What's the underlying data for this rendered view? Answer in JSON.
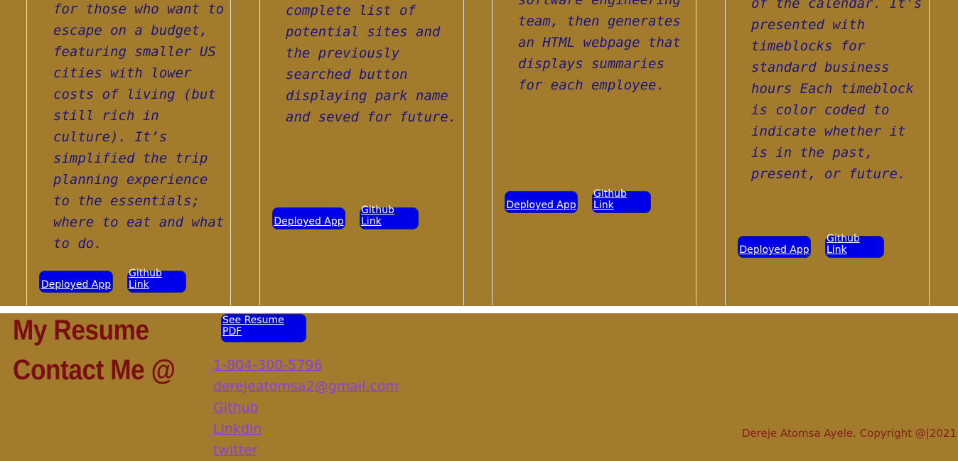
{
  "projects": [
    {
      "description": "for those who want to\nescape on a budget,\nfeaturing smaller US\ncities with lower\ncosts of living (but\nstill rich in\nculture). It’s\nsimplified the trip\nplanning experience\nto the essentials;\nwhere to eat and what\nto do.",
      "deployed_label": "Deployed App",
      "github_label": "Github Link"
    },
    {
      "description": "complete list of\npotential sites and\nthe previously\nsearched button\ndisplaying park name\nand seved for future.",
      "deployed_label": "Deployed App",
      "github_label": "Github Link"
    },
    {
      "description": "software engineering\nteam, then generates\nan HTML webpage that\ndisplays summaries\nfor each employee.",
      "deployed_label": "Deployed App",
      "github_label": "Github Link"
    },
    {
      "description": "of the calendar. It's\npresented with\ntimeblocks for\nstandard business\nhours Each timeblock\nis color coded to\nindicate whether it\nis in the past,\npresent, or future.",
      "deployed_label": "Deployed App",
      "github_label": "Github Link"
    }
  ],
  "footer": {
    "resume_heading": "My Resume",
    "resume_button": "See Resume PDF",
    "contact_heading": "Contact Me @",
    "contact_links": [
      "1-804-300-5796",
      "derejeatomsa2@gmail.com",
      "Github",
      "Linkdin",
      "twitter"
    ],
    "copyright": "Dereje Atomsa Ayele. Copyright @|2021"
  },
  "colors": {
    "background": "#a37b2d",
    "button": "#0000e8",
    "heading": "#7a0f0f",
    "description_text": "#1b1480",
    "link": "#8a3fd6"
  }
}
